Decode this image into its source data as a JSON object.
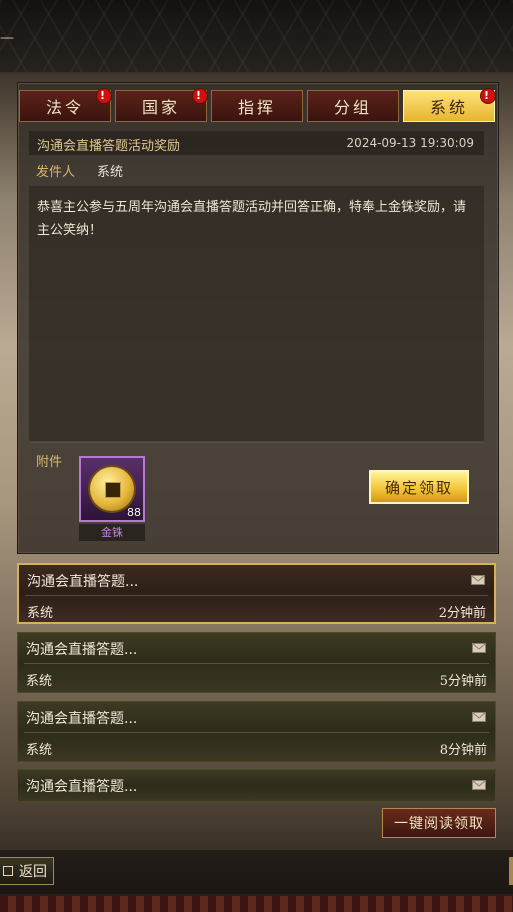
{
  "tabs": [
    {
      "label": "法令",
      "badge": "!",
      "active": false
    },
    {
      "label": "国家",
      "badge": "!",
      "active": false
    },
    {
      "label": "指挥",
      "badge": "",
      "active": false
    },
    {
      "label": "分组",
      "badge": "",
      "active": false
    },
    {
      "label": "系统",
      "badge": "!",
      "active": true
    }
  ],
  "message": {
    "title": "沟通会直播答题活动奖励",
    "time": "2024-09-13 19:30:09",
    "sender_label": "发件人",
    "sender": "系统",
    "body": "恭喜主公参与五周年沟通会直播答题活动并回答正确，特奉上金铢奖励，请主公笑纳！",
    "attachment_label": "附件",
    "item": {
      "name": "金铢",
      "quantity": "88"
    },
    "claim_label": "确定领取"
  },
  "mail_list": [
    {
      "title": "沟通会直播答题...",
      "sender": "系统",
      "time": "2分钟前",
      "selected": true
    },
    {
      "title": "沟通会直播答题...",
      "sender": "系统",
      "time": "5分钟前",
      "selected": false
    },
    {
      "title": "沟通会直播答题...",
      "sender": "系统",
      "time": "8分钟前",
      "selected": false
    },
    {
      "title": "沟通会直播答题...",
      "sender": "",
      "time": "",
      "selected": false
    }
  ],
  "read_all_label": "一键阅读领取",
  "back_label": "返回",
  "icons": {
    "back": "back-arrow-icon",
    "envelope": "envelope-icon",
    "coin": "gold-coin-icon"
  },
  "colors": {
    "active_tab": "#f3c63a",
    "claim_button": "#f3c63a",
    "badge": "#c8140c",
    "item_rarity": "#b27ad0"
  }
}
